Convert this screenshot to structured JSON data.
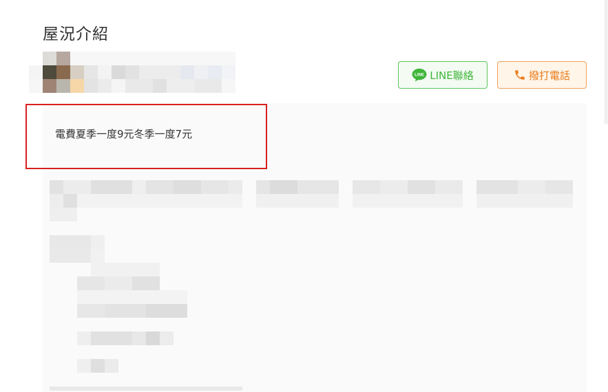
{
  "section": {
    "title": "屋況介紹"
  },
  "buttons": {
    "line_label": "LINE聯絡",
    "line_badge": "LINE",
    "call_label": "撥打電話"
  },
  "description": {
    "note": "電費夏季一度9元冬季一度7元"
  },
  "colors": {
    "line_green": "#3fb63a",
    "call_orange": "#ea7b1a",
    "highlight_red": "#d91f1f"
  },
  "icons": [
    "line-chat-icon",
    "phone-icon"
  ]
}
